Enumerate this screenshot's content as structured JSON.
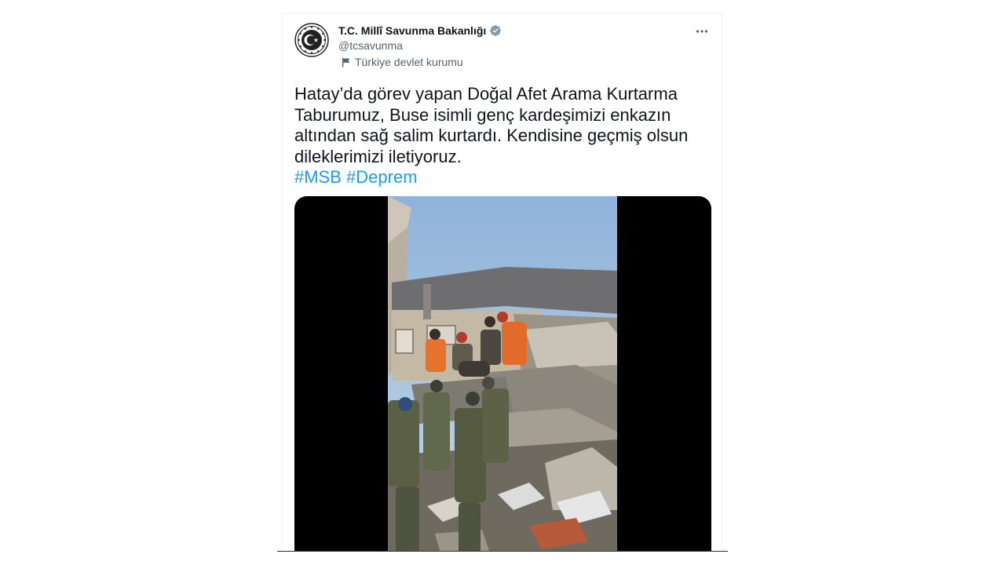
{
  "author": {
    "display_name": "T.C. Millî Savunma Bakanlığı",
    "handle": "@tcsavunma",
    "affiliation": "Türkiye devlet kurumu",
    "verified_color": "#829aab"
  },
  "menu": {
    "more_icon": "more-horizontal-icon"
  },
  "tweet": {
    "text_lines": [
      "Hatay’da görev yapan Doğal Afet Arama Kurtarma",
      "Taburumuz, Buse isimli genç kardeşimizi enkazın",
      "altından sağ salim kurtardı. Kendisine geçmiş olsun",
      "dileklerimizi iletiyoruz."
    ],
    "hashtags": [
      "#MSB",
      "#Deprem"
    ],
    "hashtag_color": "#1d9bf0"
  },
  "media": {
    "type": "video"
  }
}
